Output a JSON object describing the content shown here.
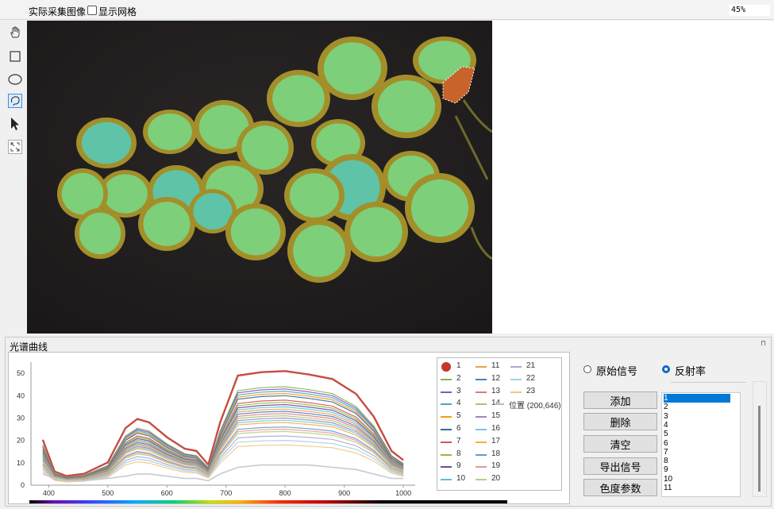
{
  "toolbar": {
    "title": "实际采集图像",
    "show_grid_label": "显示网格",
    "zoom": "45%"
  },
  "tools": [
    {
      "name": "hand-icon"
    },
    {
      "name": "rectangle-icon"
    },
    {
      "name": "ellipse-icon"
    },
    {
      "name": "lasso-icon"
    },
    {
      "name": "pointer-icon"
    },
    {
      "name": "fit-view-icon"
    }
  ],
  "spectrum": {
    "panel_title": "光谱曲线",
    "position_label": "位置 (200,646)"
  },
  "controls": {
    "radio_raw": "原始信号",
    "radio_reflectance": "反射率",
    "btn_add": "添加",
    "btn_delete": "删除",
    "btn_clear": "清空",
    "btn_export": "导出信号",
    "btn_color": "色度参数",
    "list_items": [
      "1",
      "2",
      "3",
      "4",
      "5",
      "6",
      "7",
      "8",
      "9",
      "10",
      "11"
    ]
  },
  "chart_data": {
    "type": "line",
    "x_ticks": [
      "400",
      "500",
      "600",
      "700",
      "800",
      "900",
      "1000"
    ],
    "y_ticks": [
      "0",
      "10",
      "20",
      "30",
      "40",
      "50"
    ],
    "xlim": [
      370,
      1020
    ],
    "ylim": [
      0,
      55
    ],
    "x": [
      390,
      410,
      430,
      460,
      500,
      530,
      550,
      570,
      600,
      630,
      650,
      670,
      690,
      720,
      760,
      800,
      840,
      880,
      920,
      950,
      980,
      1000
    ],
    "shape": [
      0.3,
      0.12,
      0.08,
      0.1,
      0.2,
      0.5,
      0.58,
      0.55,
      0.42,
      0.32,
      0.3,
      0.18,
      0.55,
      0.96,
      0.99,
      1.0,
      0.97,
      0.93,
      0.8,
      0.6,
      0.3,
      0.22
    ],
    "peaks": [
      51,
      44,
      43,
      42,
      41,
      40,
      38,
      37,
      36,
      35,
      34,
      33,
      32,
      31,
      30,
      29,
      28,
      26,
      25,
      24,
      22,
      20,
      18
    ],
    "low_curve": {
      "y": [
        5,
        3,
        2,
        2,
        3,
        4,
        5,
        5,
        4,
        3,
        3,
        2,
        5,
        8,
        9,
        9,
        9,
        8,
        7,
        5,
        3,
        3
      ]
    },
    "series": [
      {
        "name": "1",
        "color": "#c0392b"
      },
      {
        "name": "2",
        "color": "#8cb34a"
      },
      {
        "name": "3",
        "color": "#7e57c2"
      },
      {
        "name": "4",
        "color": "#4aa3c8"
      },
      {
        "name": "5",
        "color": "#f39c12"
      },
      {
        "name": "6",
        "color": "#2e6da4"
      },
      {
        "name": "7",
        "color": "#d9534f"
      },
      {
        "name": "8",
        "color": "#8fbc3f"
      },
      {
        "name": "9",
        "color": "#6a4c9c"
      },
      {
        "name": "10",
        "color": "#5bc0de"
      },
      {
        "name": "11",
        "color": "#f0a050"
      },
      {
        "name": "12",
        "color": "#4a7fc1"
      },
      {
        "name": "13",
        "color": "#e07b7b"
      },
      {
        "name": "14",
        "color": "#a4c86a"
      },
      {
        "name": "15",
        "color": "#9a86c4"
      },
      {
        "name": "16",
        "color": "#7cc4dc"
      },
      {
        "name": "17",
        "color": "#f5b041"
      },
      {
        "name": "18",
        "color": "#6f97cc"
      },
      {
        "name": "19",
        "color": "#e59a9a"
      },
      {
        "name": "20",
        "color": "#b6d17e"
      },
      {
        "name": "21",
        "color": "#b3a3d6"
      },
      {
        "name": "22",
        "color": "#9fd3e6"
      },
      {
        "name": "23",
        "color": "#f7c27a"
      }
    ]
  }
}
